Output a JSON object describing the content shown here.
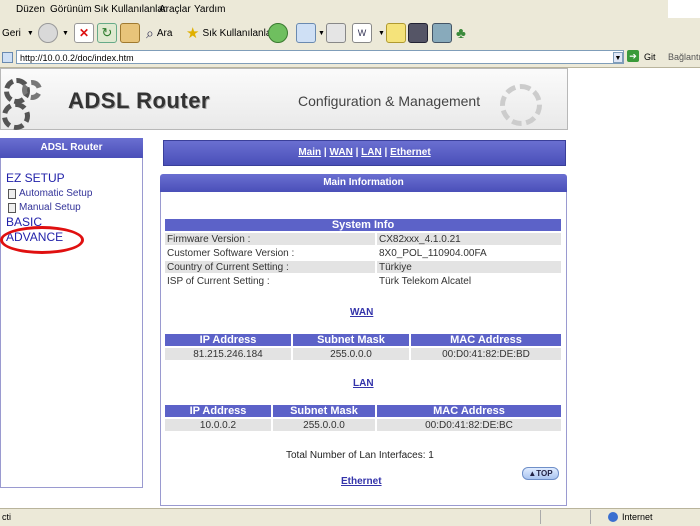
{
  "menu": [
    "Düzen",
    "Görünüm",
    "Sık Kullanılanlar",
    "Araçlar",
    "Yardım"
  ],
  "toolbar": {
    "back_label": "Geri",
    "search_label": "Ara",
    "favorites_label": "Sık Kullanılanlar"
  },
  "address": {
    "url": "http://10.0.0.2/doc/index.htm",
    "go_label": "Git",
    "links_label": "Bağlantı"
  },
  "header": {
    "title": "ADSL Router",
    "subtitle": "Configuration & Management"
  },
  "sidebar": {
    "title": "ADSL Router",
    "ez_setup": "EZ SETUP",
    "automatic_setup": "Automatic Setup",
    "manual_setup": "Manual Setup",
    "basic": "BASIC",
    "advance": "ADVANCE"
  },
  "nav": {
    "main": "Main",
    "wan": "WAN",
    "lan": "LAN",
    "ethernet": "Ethernet",
    "sep": " | "
  },
  "main": {
    "title": "Main Information",
    "system_info_title": "System Info",
    "system_info": [
      {
        "key": "Firmware Version :",
        "value": "CX82xxx_4.1.0.21"
      },
      {
        "key": "Customer Software Version :",
        "value": "8X0_POL_110904.00FA"
      },
      {
        "key": "Country of Current Setting :",
        "value": "Türkiye"
      },
      {
        "key": "ISP of Current Setting :",
        "value": "Türk Telekom Alcatel"
      }
    ],
    "wan_link": "WAN",
    "wan_headers": [
      "IP Address",
      "Subnet Mask",
      "MAC Address"
    ],
    "wan_row": [
      "81.215.246.184",
      "255.0.0.0",
      "00:D0:41:82:DE:BD"
    ],
    "lan_link": "LAN",
    "lan_headers": [
      "IP Address",
      "Subnet Mask",
      "MAC Address"
    ],
    "lan_row": [
      "10.0.0.2",
      "255.0.0.0",
      "00:D0:41:82:DE:BC"
    ],
    "total_lan": "Total Number of Lan Interfaces: 1",
    "top_button": "TOP",
    "ethernet_link": "Ethernet"
  },
  "status": {
    "text": "cti",
    "zone": "Internet"
  },
  "colors": {
    "header_blue": "#5c62c8",
    "link_blue": "#3333aa",
    "annotation_red": "#e01010"
  }
}
